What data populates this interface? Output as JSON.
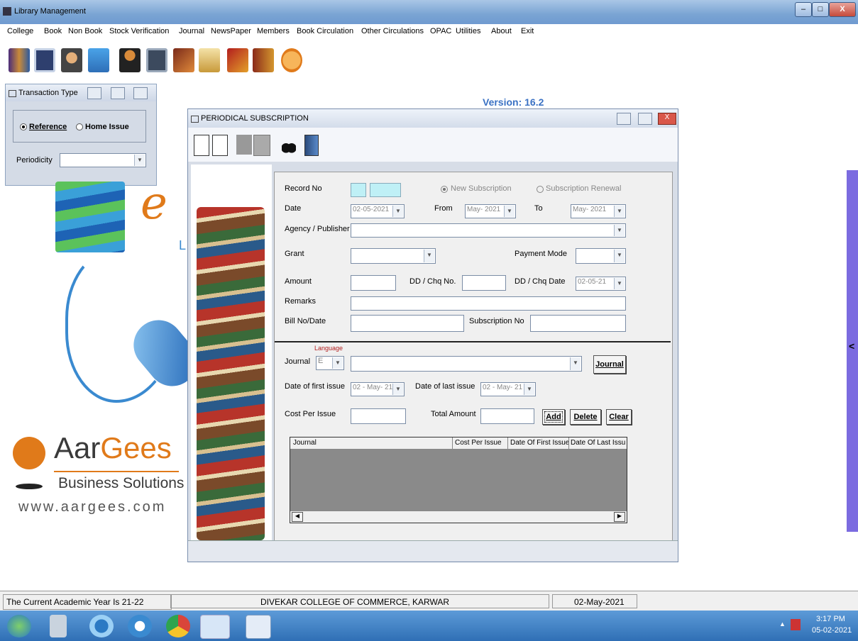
{
  "window": {
    "title": "Library Management",
    "minimize": "–",
    "maximize": "□",
    "close": "X"
  },
  "menu": [
    "College",
    "Book",
    "Non Book",
    "Stock Verification",
    "Journal",
    "NewsPaper",
    "Members",
    "Book Circulation",
    "Other Circulations",
    "OPAC",
    "Utilities",
    "About",
    "Exit"
  ],
  "toolbar_icons": [
    "books-icon",
    "calendar-icon",
    "member-icon",
    "computer-icon",
    "person-icon",
    "card-icon",
    "return-icon",
    "bookmark-icon",
    "checkmark-icon",
    "door-icon",
    "logo-icon"
  ],
  "transaction": {
    "title": "Transaction Type",
    "reference": "Reference",
    "home_issue": "Home Issue",
    "periodicity_label": "Periodicity",
    "periodicity_value": ""
  },
  "version": "Version: 16.2",
  "brand": {
    "name1": "Aar",
    "name2": "Gees",
    "tagline": "Business Solutions",
    "url": "www.aargees.com",
    "letter": "e",
    "letter2": "L"
  },
  "periodical": {
    "title": "PERIODICAL SUBSCRIPTION",
    "record_no_label": "Record No",
    "new_subscription": "New Subscription",
    "subscription_renewal": "Subscription Renewal",
    "date_label": "Date",
    "date_value": "02-05-2021",
    "from_label": "From",
    "from_value": "May- 2021",
    "to_label": "To",
    "to_value": "May- 2021",
    "agency_label": "Agency / Publisher",
    "grant_label": "Grant",
    "payment_mode_label": "Payment Mode",
    "amount_label": "Amount",
    "dd_chq_no_label": "DD / Chq  No.",
    "dd_chq_date_label": "DD / Chq  Date",
    "dd_chq_date_value": "02-05-21",
    "remarks_label": "Remarks",
    "bill_label": "Bill No/Date",
    "subscription_no_label": "Subscription No",
    "language_label": "Language",
    "journal_label": "Journal",
    "language_value": "E",
    "journal_button": "Journal",
    "first_issue_label": "Date of first issue",
    "first_issue_value": "02 - May- 21",
    "last_issue_label": "Date of last issue",
    "last_issue_value": "02 - May- 21",
    "cost_label": "Cost Per Issue",
    "total_label": "Total Amount",
    "add_button": "Add",
    "delete_button": "Delete",
    "clear_button": "Clear",
    "grid_columns": [
      "Journal",
      "Cost  Per Issue",
      "Date Of First Issue",
      "Date Of Last Issu"
    ]
  },
  "status": {
    "academic_year": "The Current Academic Year Is 21-22",
    "college": "DIVEKAR COLLEGE OF COMMERCE, KARWAR",
    "date": "02-May-2021"
  },
  "taskbar": {
    "time": "3:17 PM",
    "date": "05-02-2021"
  },
  "colors": {
    "accent": "#3b72c4",
    "orange": "#e07a1a",
    "field_cyan": "#bff0f6",
    "grid_bg": "#8a8a8a"
  }
}
